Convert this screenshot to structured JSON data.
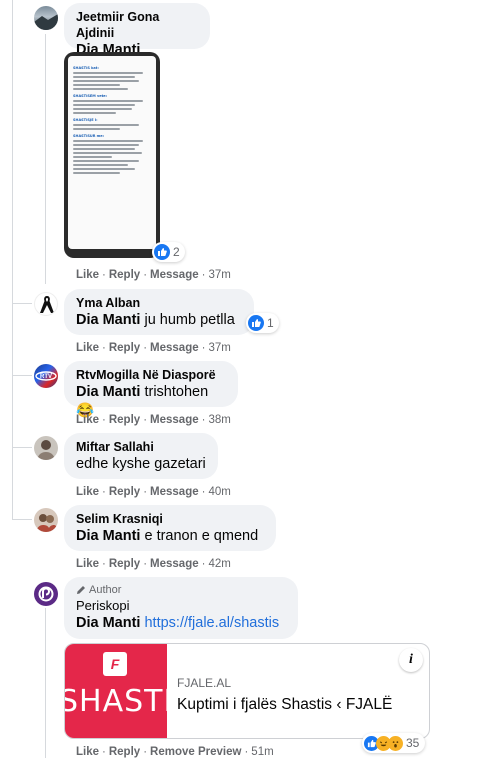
{
  "comments": [
    {
      "author": "Jeetmiir Gona Ajdinii",
      "mention": "Dia Manti",
      "text": "",
      "attachment": {
        "headings": [
          "SHASTIS kat:",
          "SHASTISEM vete:",
          "SHASTISJE I:",
          "SHASTISUR me:"
        ],
        "reaction_count": "2"
      },
      "actions": [
        "Like",
        "Reply",
        "Message"
      ],
      "time": "37m"
    },
    {
      "author": "Yma Alban",
      "mention": "Dia Manti",
      "text": " ju humb petlla",
      "reaction_count": "1",
      "actions": [
        "Like",
        "Reply",
        "Message"
      ],
      "time": "37m"
    },
    {
      "author": "RtvMogilla Në Diasporë",
      "mention": "Dia Manti",
      "text": " trishtohen😂",
      "actions": [
        "Like",
        "Reply",
        "Message"
      ],
      "time": "38m"
    },
    {
      "author": "Miftar Sallahi",
      "mention": "",
      "text": "edhe kyshe gazetari",
      "actions": [
        "Like",
        "Reply",
        "Message"
      ],
      "time": "40m"
    },
    {
      "author": "Selim Krasniqi",
      "mention": "Dia Manti",
      "text": " e tranon e qmend",
      "actions": [
        "Like",
        "Reply",
        "Message"
      ],
      "time": "42m"
    },
    {
      "badge": "Author",
      "author": "Periskopi",
      "mention": "Dia Manti",
      "link": "https://fjale.al/shastis",
      "preview": {
        "logo_letter": "F",
        "image_word": "SHASTIS",
        "domain": "FJALE.AL",
        "title": "Kuptimi i fjalës Shastis ‹ FJALË",
        "info_icon": "i"
      },
      "reaction_count": "35",
      "actions": [
        "Like",
        "Reply",
        "Remove Preview"
      ],
      "time": "51m"
    }
  ],
  "colors": {
    "bubble": "#f0f2f5",
    "link": "#216fdb",
    "like": "#1877f2",
    "preview_red": "#e4274a",
    "meta": "#65676b"
  },
  "icons": [
    "like-icon",
    "haha-icon",
    "wow-icon",
    "pencil-icon",
    "info-icon",
    "black-ribbon-icon"
  ]
}
